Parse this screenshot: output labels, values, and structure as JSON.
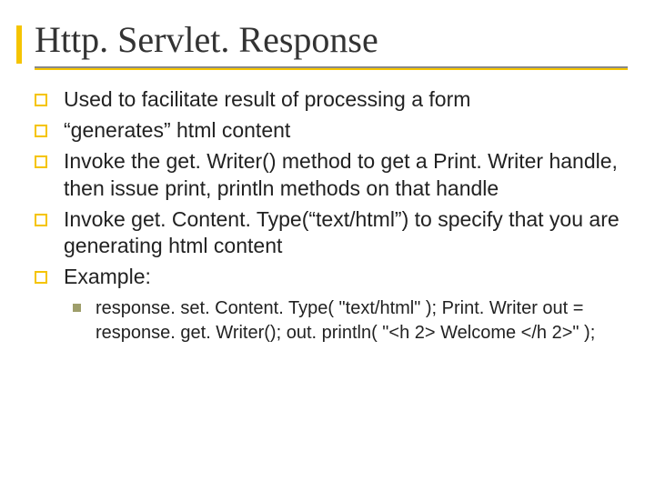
{
  "slide": {
    "title": "Http. Servlet. Response",
    "bullets": [
      "Used to facilitate result of processing a form",
      "“generates” html content",
      "Invoke the get. Writer() method to get a Print. Writer handle, then issue print, println methods on that handle",
      "Invoke get. Content. Type(“text/html”) to specify that you are generating html content",
      "Example:"
    ],
    "sub": [
      "response. set. Content. Type( \"text/html\" ); Print. Writer out = response. get. Writer(); out. println( \"<h 2> Welcome </h 2>\" );"
    ]
  }
}
